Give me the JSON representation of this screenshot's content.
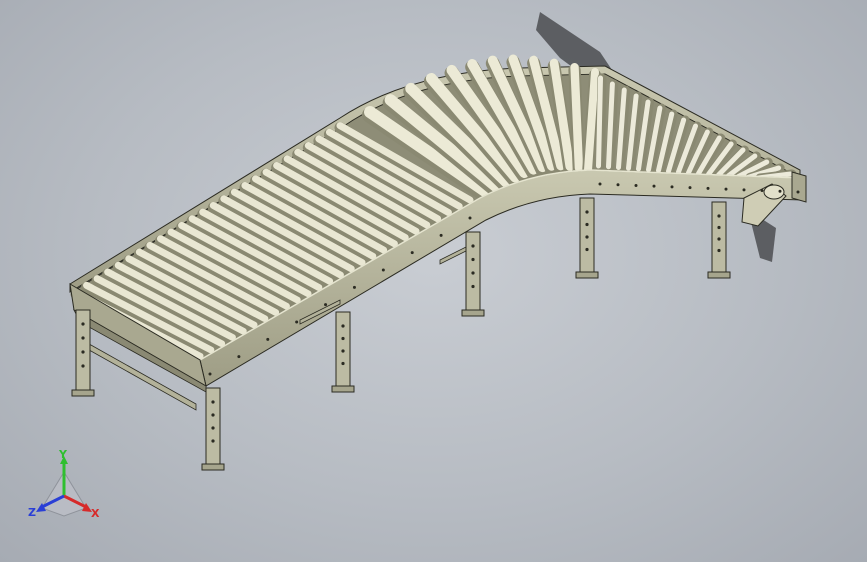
{
  "scene": {
    "model": "curved-roller-conveyor",
    "colors": {
      "background_center": "#c9cdd3",
      "background_edge": "#a6abb3",
      "frame": "#bdbca4",
      "frame_dark": "#85846c",
      "roller": "#e8e6d2",
      "roller_shadow": "#9b9a84",
      "edge_line": "#2b2b22"
    }
  },
  "triad": {
    "x_label": "X",
    "y_label": "Y",
    "z_label": "Z",
    "x_color": "#d62a2a",
    "y_color": "#2fbf2f",
    "z_color": "#2a3fd6"
  }
}
